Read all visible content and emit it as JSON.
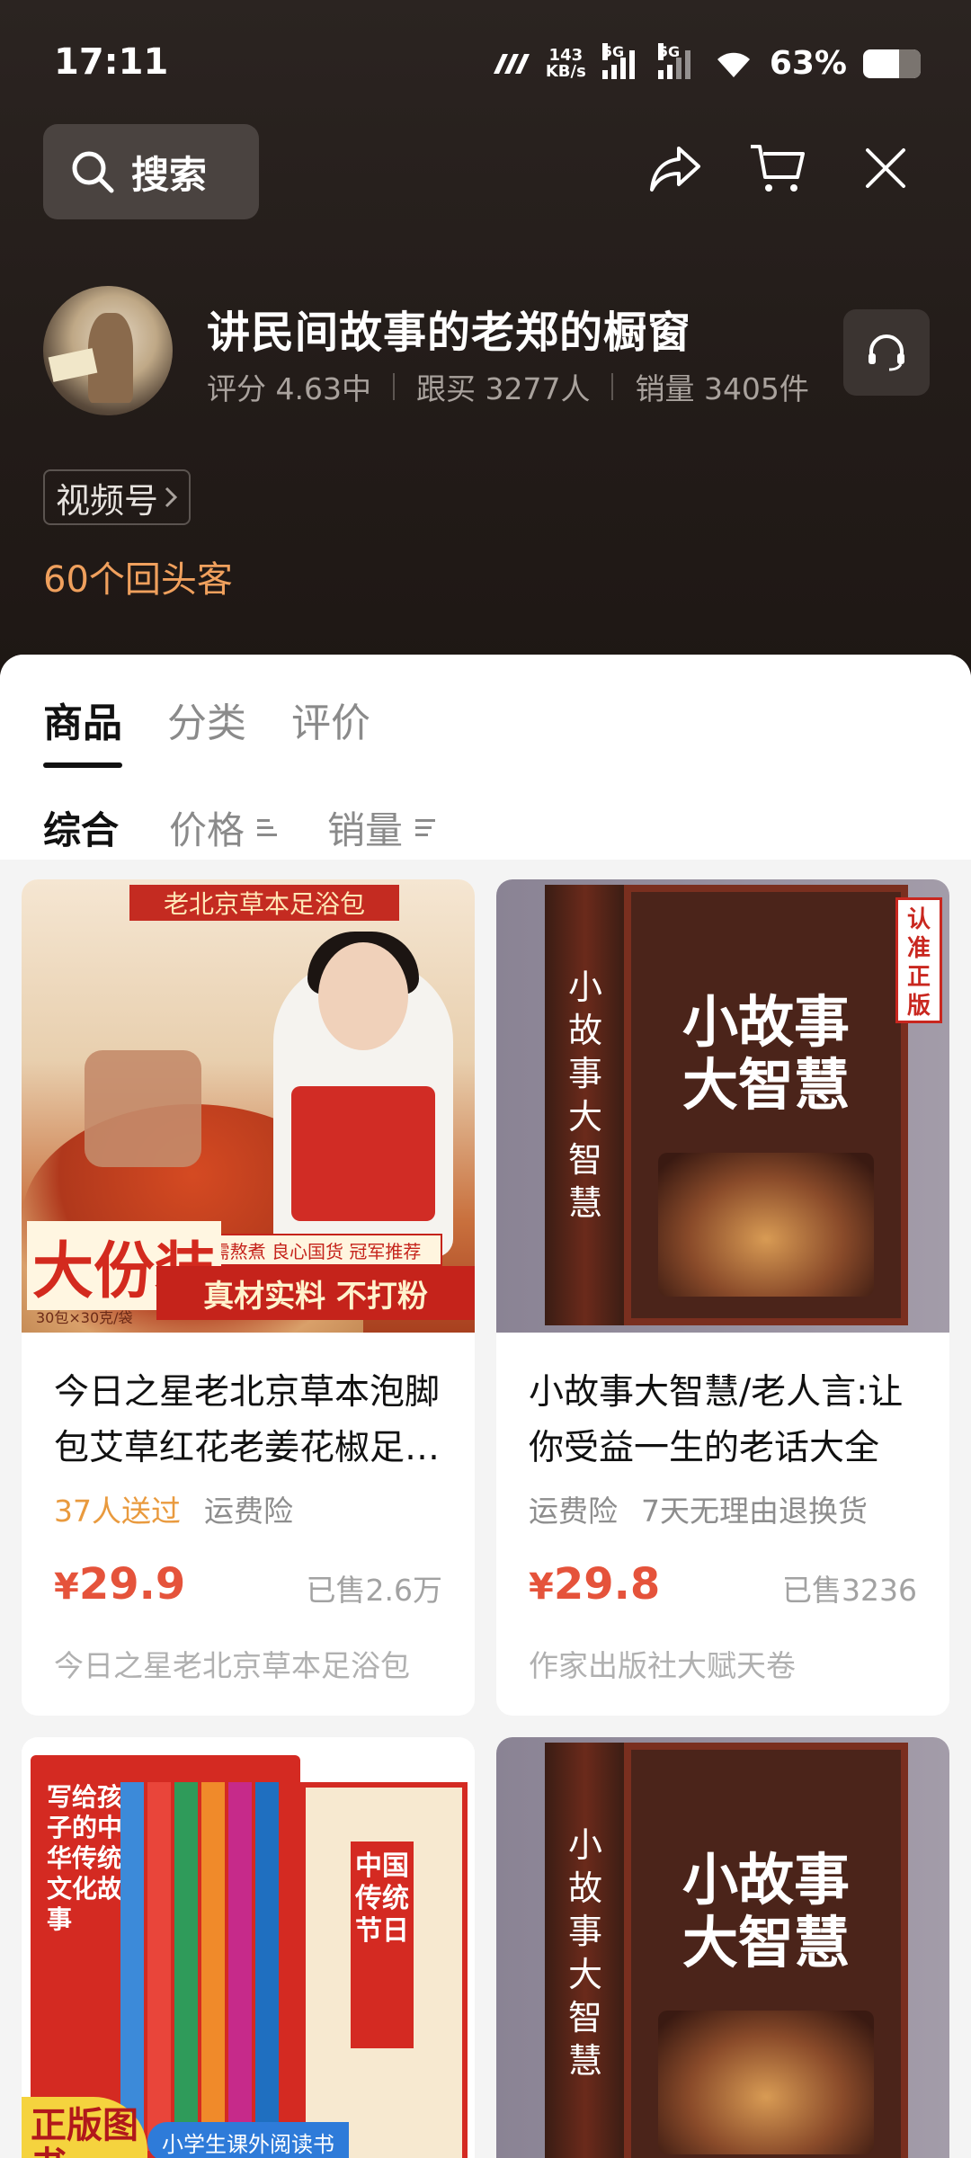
{
  "status_bar": {
    "time": "17:11",
    "speed_value": "143",
    "speed_unit": "KB/s",
    "network_1": "5G",
    "network_2": "5G",
    "battery_pct": "63%",
    "battery_level": 0.63
  },
  "top_bar": {
    "search_label": "搜索",
    "icons": [
      "share-icon",
      "cart-icon",
      "close-icon"
    ]
  },
  "shop": {
    "name": "讲民间故事的老郑的橱窗",
    "rating": "评分 4.63中",
    "followers": "跟买 3277人",
    "sales": "销量 3405件",
    "channel": "视频号",
    "repeat_customers": "60个回头客"
  },
  "tabs": [
    {
      "label": "商品",
      "active": true
    },
    {
      "label": "分类",
      "active": false
    },
    {
      "label": "评价",
      "active": false
    }
  ],
  "sort": [
    {
      "label": "综合",
      "active": true
    },
    {
      "label": "价格",
      "active": false
    },
    {
      "label": "销量",
      "active": false
    }
  ],
  "products": [
    {
      "title": "今日之星老北京草本泡脚包艾草红花老姜花椒足浴包",
      "tags": [
        "37人送过",
        "运费险"
      ],
      "price_currency": "¥",
      "price": "29.9",
      "sold": "已售2.6万",
      "shop": "今日之星老北京草本足浴包",
      "image_text": {
        "banner": "老北京草本足浴包",
        "big": "大份装",
        "sub": "无需熬煮 良心国货 冠军推荐",
        "strip": "真材实料 不打粉",
        "spec": "30包×30克/袋"
      }
    },
    {
      "title": "小故事大智慧/老人言:让你受益一生的老话大全",
      "tags": [
        "运费险",
        "7天无理由退换货"
      ],
      "price_currency": "¥",
      "price": "29.8",
      "sold": "已售3236",
      "shop": "作家出版社大赋天卷",
      "image_text": {
        "spine": "小故事 大智慧",
        "cover": "小故事 大智慧",
        "seal": "认准正版"
      }
    },
    {
      "image_text": {
        "box_label": "写给孩子的中华传统文化故事",
        "front": "中国传统节日",
        "ribbon": "小学生课外阅读书",
        "badge": "正版图书"
      }
    },
    {
      "image_text": {
        "spine": "小故事 大智慧",
        "cover": "小故事 大智慧"
      }
    }
  ]
}
